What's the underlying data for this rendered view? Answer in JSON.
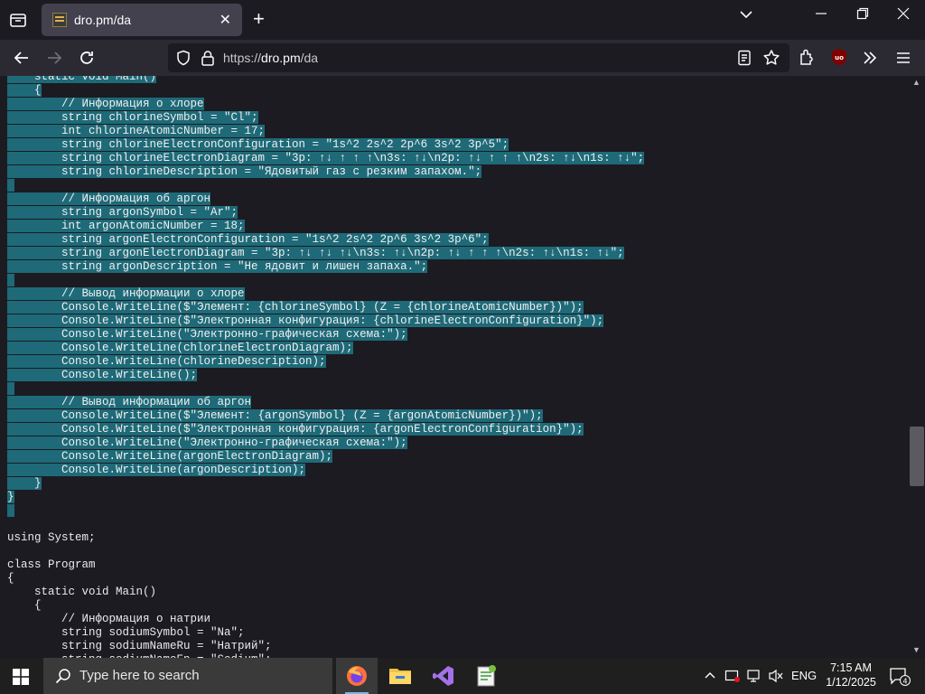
{
  "browser": {
    "tab_title": "dro.pm/da",
    "url_prefix": "https://",
    "url_host": "dro.pm",
    "url_path": "/da"
  },
  "code_lines": [
    "    static void Main()",
    "    {",
    "        // Информация о хлоре",
    "        string chlorineSymbol = \"Cl\";",
    "        int chlorineAtomicNumber = 17;",
    "        string chlorineElectronConfiguration = \"1s^2 2s^2 2p^6 3s^2 3p^5\";",
    "        string chlorineElectronDiagram = \"3p: ↑↓ ↑ ↑ ↑\\n3s: ↑↓\\n2p: ↑↓ ↑ ↑ ↑\\n2s: ↑↓\\n1s: ↑↓\";",
    "        string chlorineDescription = \"Ядовитый газ с резким запахом.\";",
    "",
    "        // Информация об аргон",
    "        string argonSymbol = \"Ar\";",
    "        int argonAtomicNumber = 18;",
    "        string argonElectronConfiguration = \"1s^2 2s^2 2p^6 3s^2 3p^6\";",
    "        string argonElectronDiagram = \"3p: ↑↓ ↑↓ ↑↓\\n3s: ↑↓\\n2p: ↑↓ ↑ ↑ ↑\\n2s: ↑↓\\n1s: ↑↓\";",
    "        string argonDescription = \"Не ядовит и лишен запаха.\";",
    "",
    "        // Вывод информации о хлоре",
    "        Console.WriteLine($\"Элемент: {chlorineSymbol} (Z = {chlorineAtomicNumber})\");",
    "        Console.WriteLine($\"Электронная конфигурация: {chlorineElectronConfiguration}\");",
    "        Console.WriteLine(\"Электронно-графическая схема:\");",
    "        Console.WriteLine(chlorineElectronDiagram);",
    "        Console.WriteLine(chlorineDescription);",
    "        Console.WriteLine();",
    "",
    "        // Вывод информации об аргон",
    "        Console.WriteLine($\"Элемент: {argonSymbol} (Z = {argonAtomicNumber})\");",
    "        Console.WriteLine($\"Электронная конфигурация: {argonElectronConfiguration}\");",
    "        Console.WriteLine(\"Электронно-графическая схема:\");",
    "        Console.WriteLine(argonElectronDiagram);",
    "        Console.WriteLine(argonDescription);",
    "    }",
    "}",
    "",
    "",
    "using System;",
    "",
    "class Program",
    "{",
    "    static void Main()",
    "    {",
    "        // Информация о натрии",
    "        string sodiumSymbol = \"Na\";",
    "        string sodiumNameRu = \"Натрий\";",
    "        string sodiumNameEn = \"Sodium\";"
  ],
  "selected_line_count": 33,
  "taskbar": {
    "search_placeholder": "Type here to search",
    "language": "ENG",
    "time": "7:15 AM",
    "date": "1/12/2025",
    "notification_count": "4"
  },
  "colors": {
    "selection": "#1e6a78",
    "page_bg": "#1c1b22",
    "toolbar_bg": "#2b2a33"
  }
}
